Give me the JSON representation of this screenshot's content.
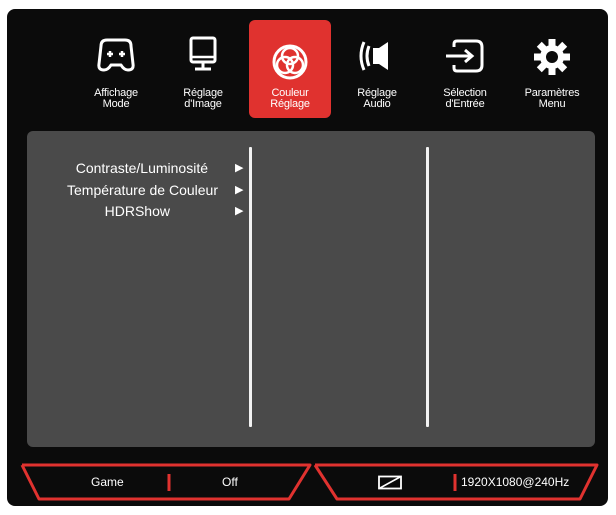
{
  "tabs": [
    {
      "id": "affichage",
      "line1": "Affichage",
      "line2": "Mode",
      "icon": "gamepad-icon",
      "active": false
    },
    {
      "id": "image",
      "line1": "Réglage",
      "line2": "d'Image",
      "icon": "monitor-icon",
      "active": false
    },
    {
      "id": "couleur",
      "line1": "Couleur",
      "line2": "Réglage",
      "icon": "color-circles-icon",
      "active": true
    },
    {
      "id": "audio",
      "line1": "Réglage",
      "line2": "Audio",
      "icon": "speaker-icon",
      "active": false
    },
    {
      "id": "entree",
      "line1": "Sélection",
      "line2": "d'Entrée",
      "icon": "input-source-icon",
      "active": false
    },
    {
      "id": "menu",
      "line1": "Paramètres",
      "line2": "Menu",
      "icon": "gear-icon",
      "active": false
    }
  ],
  "menu": {
    "items": [
      {
        "label": "Contraste/Luminosité",
        "arrow": "▶"
      },
      {
        "label": "Température de Couleur",
        "arrow": "▶"
      },
      {
        "label": "HDRShow",
        "arrow": "▶"
      }
    ]
  },
  "status": {
    "mode": "Game",
    "setting": "Off",
    "icon": "aspect-ratio-icon",
    "resolution": "1920X1080@240Hz"
  },
  "colors": {
    "accent": "#e0322f",
    "panel": "#4a4a4a",
    "background": "#0b0b0b"
  }
}
